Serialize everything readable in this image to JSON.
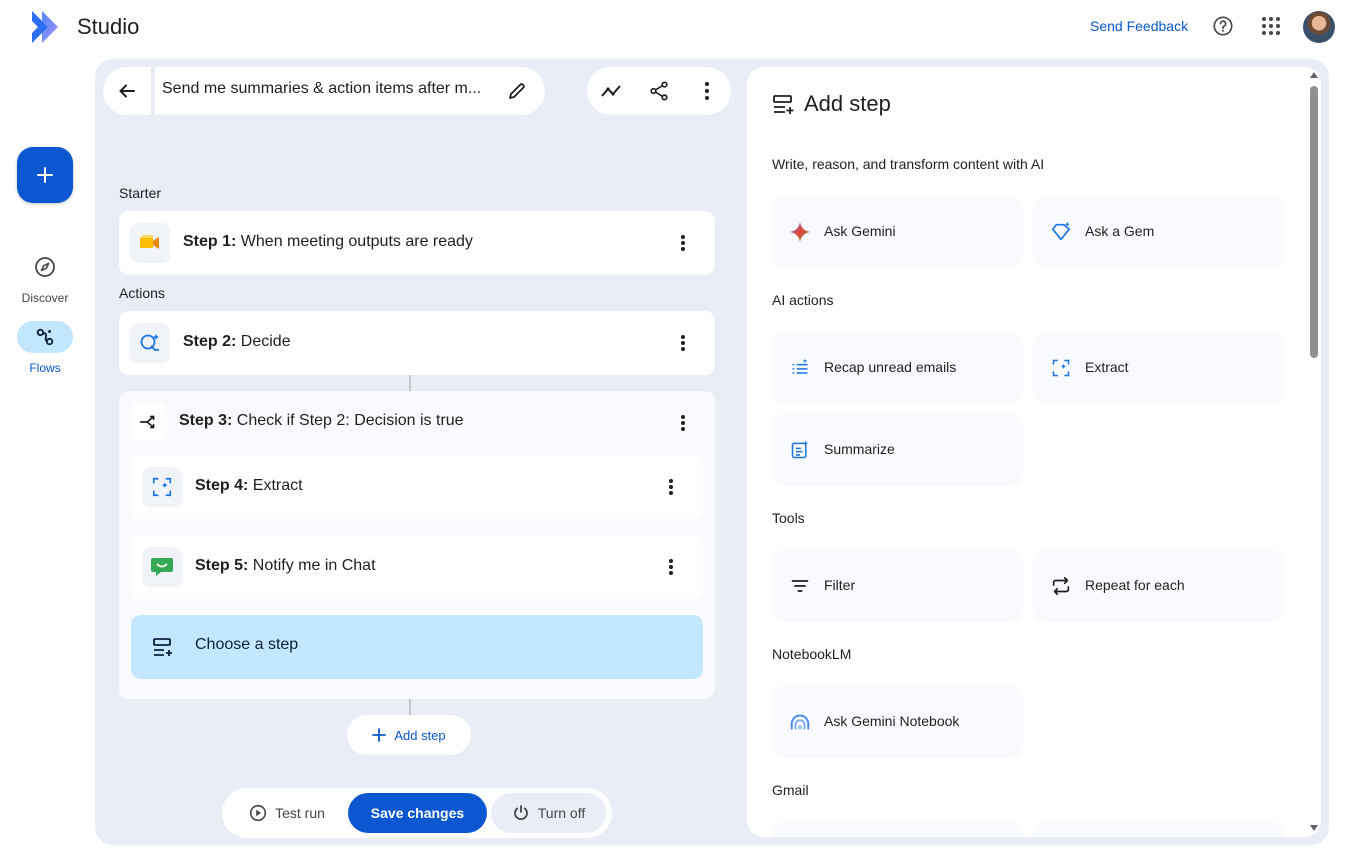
{
  "app": {
    "title": "Studio",
    "feedback": "Send Feedback"
  },
  "rail": {
    "discover": "Discover",
    "flows": "Flows"
  },
  "flow": {
    "title": "Send me summaries & action items after m...",
    "starter_label": "Starter",
    "actions_label": "Actions",
    "steps": [
      {
        "num": "Step 1:",
        "text": "When meeting outputs are ready"
      },
      {
        "num": "Step 2:",
        "text": "Decide"
      },
      {
        "num": "Step 3:",
        "text": "Check if Step 2: Decision is true"
      },
      {
        "num": "Step 4:",
        "text": "Extract"
      },
      {
        "num": "Step 5:",
        "text": "Notify me in Chat"
      }
    ],
    "choose_step": "Choose a step",
    "add_step": "Add step"
  },
  "bottom": {
    "test_run": "Test run",
    "save": "Save changes",
    "turn_off": "Turn off"
  },
  "panel": {
    "title": "Add step",
    "sections": [
      "Write, reason, and transform content with AI",
      "AI actions",
      "Tools",
      "NotebookLM",
      "Gmail"
    ],
    "tools": {
      "ask_gemini": "Ask Gemini",
      "ask_gem": "Ask a Gem",
      "recap": "Recap unread emails",
      "extract": "Extract",
      "summarize": "Summarize",
      "filter": "Filter",
      "repeat": "Repeat for each",
      "notebook": "Ask Gemini Notebook"
    }
  },
  "colors": {
    "accent": "#0b57d0",
    "canvas": "#e9eef6",
    "choose_bg": "#c2e7ff"
  }
}
